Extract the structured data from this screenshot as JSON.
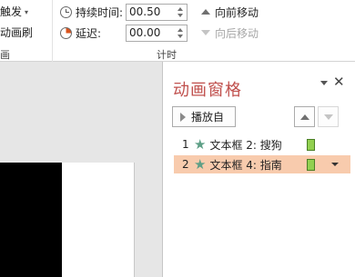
{
  "ribbon": {
    "trigger_label": "触发",
    "anim_brush_label": "动画刷",
    "advanced_group_label": "画",
    "duration_label": "持续时间:",
    "duration_value": "00.50",
    "delay_label": "延迟:",
    "delay_value": "00.00",
    "timing_group_label": "计时",
    "move_earlier": "向前移动",
    "move_later": "向后移动"
  },
  "pane": {
    "title": "动画窗格",
    "play_button": "播放自",
    "items": [
      {
        "number": "1",
        "label": "文本框 2: 搜狗"
      },
      {
        "number": "2",
        "label": "文本框 4: 指南"
      }
    ]
  },
  "colors": {
    "title_red": "#c0504d",
    "selected_bg": "#f8cbad",
    "timing_bar": "#92d050",
    "star_green": "#5e9f86"
  }
}
